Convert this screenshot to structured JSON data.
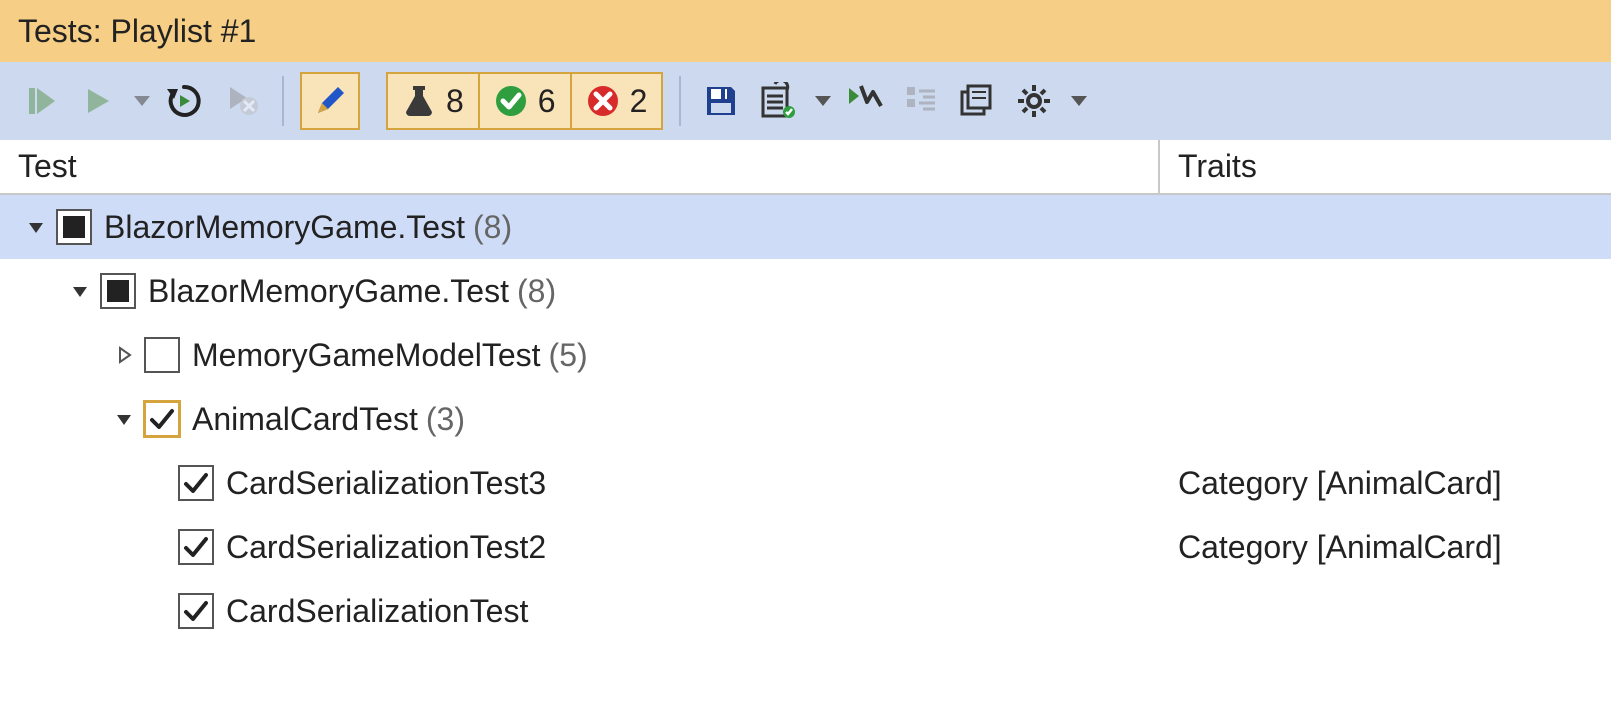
{
  "title": "Tests: Playlist #1",
  "counts": {
    "total": "8",
    "passed": "6",
    "failed": "2"
  },
  "columns": {
    "test": "Test",
    "traits": "Traits"
  },
  "tree": {
    "root": {
      "label": "BlazorMemoryGame.Test",
      "count": "(8)"
    },
    "sub": {
      "label": "BlazorMemoryGame.Test",
      "count": "(8)"
    },
    "group1": {
      "label": "MemoryGameModelTest",
      "count": "(5)"
    },
    "group2": {
      "label": "AnimalCardTest",
      "count": "(3)"
    },
    "leaf1": {
      "label": "CardSerializationTest3",
      "trait": "Category [AnimalCard]"
    },
    "leaf2": {
      "label": "CardSerializationTest2",
      "trait": "Category [AnimalCard]"
    },
    "leaf3": {
      "label": "CardSerializationTest",
      "trait": ""
    }
  }
}
